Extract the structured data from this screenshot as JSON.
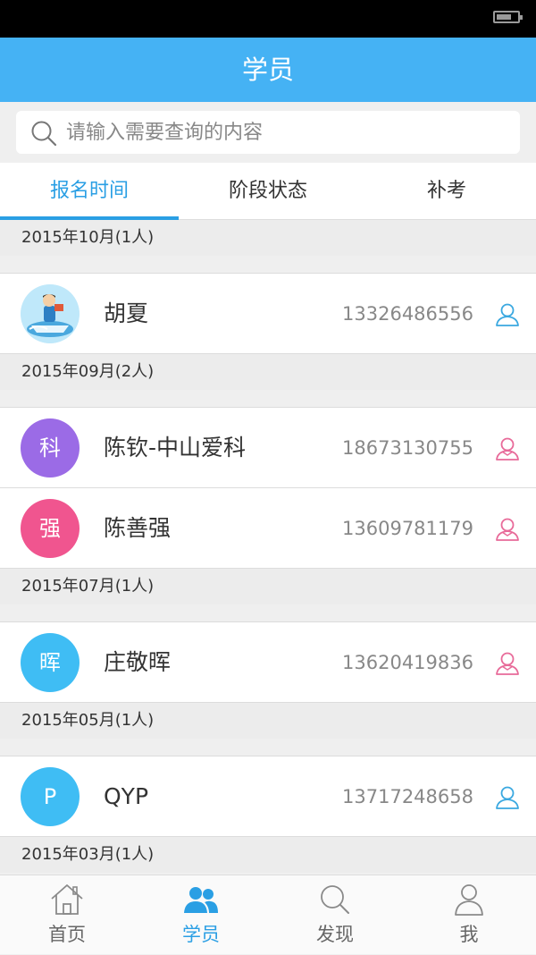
{
  "header": {
    "title": "学员"
  },
  "search": {
    "placeholder": "请输入需要查询的内容"
  },
  "tabs": [
    {
      "label": "报名时间",
      "active": true
    },
    {
      "label": "阶段状态",
      "active": false
    },
    {
      "label": "补考",
      "active": false
    }
  ],
  "groups": [
    {
      "label": "2015年10月(1人)",
      "students": [
        {
          "name": "胡夏",
          "phone": "13326486556",
          "avatar": "photo",
          "gender": "male"
        }
      ]
    },
    {
      "label": "2015年09月(2人)",
      "students": [
        {
          "name": "陈钦-中山爱科",
          "phone": "18673130755",
          "avatar_char": "科",
          "gender": "female"
        },
        {
          "name": "陈善强",
          "phone": "13609781179",
          "avatar_char": "强",
          "gender": "female"
        }
      ]
    },
    {
      "label": "2015年07月(1人)",
      "students": [
        {
          "name": "庄敬晖",
          "phone": "13620419836",
          "avatar_char": "晖",
          "gender": "female"
        }
      ]
    },
    {
      "label": "2015年05月(1人)",
      "students": [
        {
          "name": "QYP",
          "phone": "13717248658",
          "avatar_char": "P",
          "gender": "male"
        }
      ]
    },
    {
      "label": "2015年03月(1人)",
      "students": []
    }
  ],
  "tabbar": [
    {
      "label": "首页",
      "icon": "home-icon",
      "active": false
    },
    {
      "label": "学员",
      "icon": "students-icon",
      "active": true
    },
    {
      "label": "发现",
      "icon": "discover-icon",
      "active": false
    },
    {
      "label": "我",
      "icon": "profile-icon",
      "active": false
    }
  ],
  "colors": {
    "primary": "#45b2f4",
    "accent": "#2a9fe4",
    "avatar_purple": "#9b6be6",
    "avatar_pink": "#f0558f",
    "avatar_blue": "#3fbdf4",
    "male_icon": "#3aa8e0",
    "female_icon": "#e86a99"
  }
}
